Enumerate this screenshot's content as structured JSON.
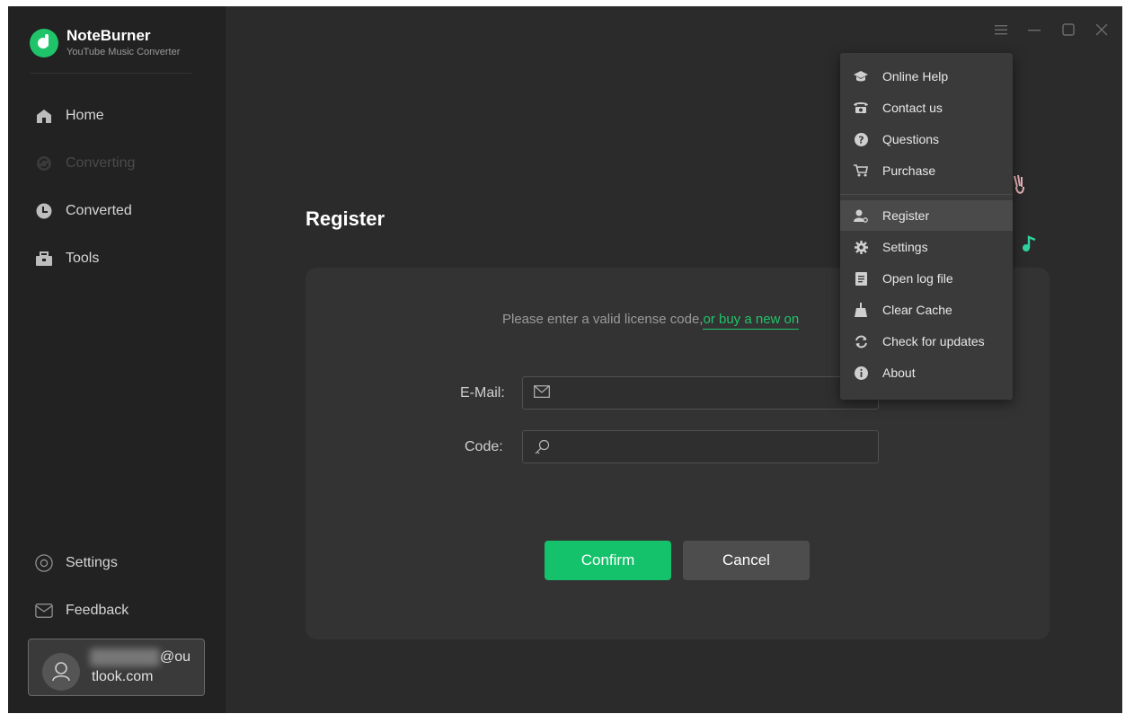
{
  "brand": {
    "name": "NoteBurner",
    "subtitle": "YouTube Music Converter",
    "accent": "#1fc46a"
  },
  "sidebar": {
    "items": [
      {
        "label": "Home",
        "icon": "home-icon"
      },
      {
        "label": "Converting",
        "icon": "converting-icon",
        "disabled": true
      },
      {
        "label": "Converted",
        "icon": "clock-icon"
      },
      {
        "label": "Tools",
        "icon": "toolbox-icon"
      }
    ],
    "bottom": [
      {
        "label": "Settings",
        "icon": "settings-icon"
      },
      {
        "label": "Feedback",
        "icon": "mail-icon"
      }
    ],
    "user": {
      "email_line1": "@ou",
      "email_line2": "tlook.com"
    }
  },
  "window": {
    "controls": [
      "menu-icon",
      "minimize-icon",
      "maximize-icon",
      "close-icon"
    ]
  },
  "register": {
    "title": "Register",
    "hint_text": "Please enter a valid license code,",
    "hint_link": "or buy a new on",
    "email_label": "E-Mail:",
    "code_label": "Code:",
    "confirm_label": "Confirm",
    "cancel_label": "Cancel"
  },
  "menu": {
    "items": [
      {
        "label": "Online Help",
        "icon": "graduation-cap-icon"
      },
      {
        "label": "Contact us",
        "icon": "phone-icon"
      },
      {
        "label": "Questions",
        "icon": "question-icon"
      },
      {
        "label": "Purchase",
        "icon": "cart-icon"
      },
      {
        "label": "Register",
        "icon": "user-key-icon",
        "active": true
      },
      {
        "label": "Settings",
        "icon": "gear-icon"
      },
      {
        "label": "Open log file",
        "icon": "file-icon"
      },
      {
        "label": "Clear Cache",
        "icon": "broom-icon"
      },
      {
        "label": "Check for updates",
        "icon": "refresh-icon"
      },
      {
        "label": "About",
        "icon": "info-icon"
      }
    ]
  }
}
